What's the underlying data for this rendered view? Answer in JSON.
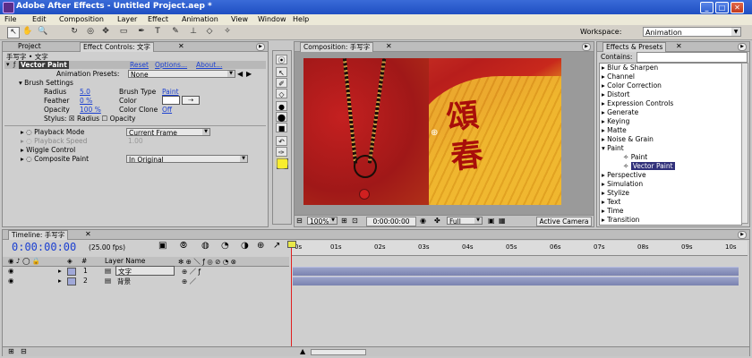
{
  "window": {
    "title": "Adobe After Effects - Untitled Project.aep *",
    "min": "_",
    "max": "□",
    "close": "✕"
  },
  "menu": [
    "File",
    "Edit",
    "Composition",
    "Layer",
    "Effect",
    "Animation",
    "View",
    "Window",
    "Help"
  ],
  "toolbar": {
    "workspace_label": "Workspace:",
    "workspace_value": "Animation"
  },
  "project_tab": "Project",
  "effect_controls": {
    "tab": "Effect Controls: 文字",
    "header": "手写字 • 文字",
    "effect_name": "Vector Paint",
    "reset": "Reset",
    "options": "Options...",
    "about": "About...",
    "presets_label": "Animation Presets:",
    "presets_value": "None",
    "brush_settings": "Brush Settings",
    "radius_label": "Radius",
    "radius_value": "5.0",
    "feather_label": "Feather",
    "feather_value": "0 %",
    "opacity_label": "Opacity",
    "opacity_value": "100 %",
    "brush_type_label": "Brush Type",
    "brush_type_value": "Paint",
    "color_label": "Color",
    "color_clone_label": "Color Clone",
    "color_clone_value": "Off",
    "stylus_label": "Stylus:",
    "stylus_radius": "Radius",
    "stylus_opacity": "Opacity",
    "playback_mode_label": "Playback Mode",
    "playback_mode_value": "Current Frame",
    "playback_speed_label": "Playback Speed",
    "playback_speed_value": "1.00",
    "wiggle_label": "Wiggle Control",
    "composite_label": "Composite Paint",
    "composite_value": "In Original"
  },
  "composition": {
    "tab": "Composition: 手写字",
    "canvas_text": "頌春",
    "zoom": "100%",
    "time": "0:00:00:00",
    "quality": "Full",
    "camera": "Active Camera"
  },
  "effects_presets": {
    "tab": "Effects & Presets",
    "contains_label": "Contains:",
    "items": [
      "Blur & Sharpen",
      "Channel",
      "Color Correction",
      "Distort",
      "Expression Controls",
      "Generate",
      "Keying",
      "Matte",
      "Noise & Grain",
      "Paint",
      "Paint",
      "Vector Paint",
      "Perspective",
      "Simulation",
      "Stylize",
      "Text",
      "Time",
      "Transition"
    ]
  },
  "timeline": {
    "tab": "Timeline: 手写字",
    "time": "0:00:00:00",
    "fps": "(25.00 fps)",
    "col_num": "#",
    "col_layer": "Layer Name",
    "ruler": [
      "0s",
      "01s",
      "02s",
      "03s",
      "04s",
      "05s",
      "06s",
      "07s",
      "08s",
      "09s",
      "10s"
    ],
    "layers": [
      {
        "num": "1",
        "name": "文字"
      },
      {
        "num": "2",
        "name": "背景"
      }
    ]
  },
  "colors": {
    "title_bar": "#2452c8",
    "canvas_red": "#c0281e",
    "canvas_orange": "#e8a020",
    "calligraphy": "#a80e0a",
    "timeline_bar": "#8a90bc",
    "playhead": "#e02020"
  }
}
